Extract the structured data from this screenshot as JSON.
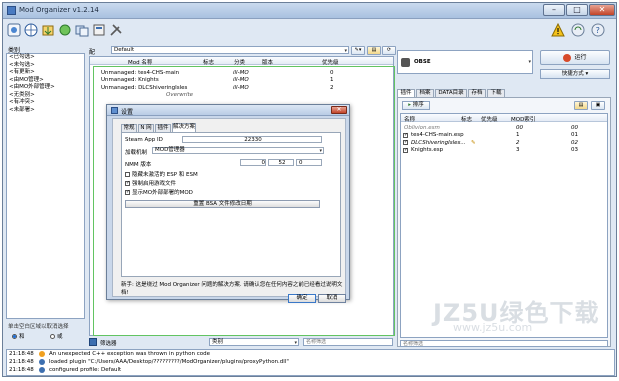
{
  "window": {
    "title": "Mod Organizer v1.2.14"
  },
  "left": {
    "title": "类别",
    "items": [
      "<已勾选>",
      "<未勾选>",
      "<有更新>",
      "<由MO管理>",
      "<由MO外部管理>",
      "<无类别>",
      "<有冲突>",
      "<未部署>"
    ],
    "footer": "单击空白区域以取消选择",
    "radio_and": "和",
    "radio_or": "或"
  },
  "profile": {
    "label": "配置文件",
    "value": "Default"
  },
  "modlist": {
    "headers": [
      "Mod 名称",
      "标志",
      "分类",
      "版本",
      "优先级"
    ],
    "overwrite": "Overwrite",
    "rows": [
      {
        "name": "Unmanaged: tes4-CHS-main",
        "cat": "ill-MO",
        "priority": "0"
      },
      {
        "name": "Unmanaged: Knights",
        "cat": "ill-MO",
        "priority": "1"
      },
      {
        "name": "Unmanaged: DLCShiveringIsles",
        "cat": "ill-MO",
        "priority": "2"
      }
    ]
  },
  "filter": {
    "label": "筛选器",
    "select": "类别",
    "placeholder": "名称筛选"
  },
  "dialog": {
    "title": "设置",
    "close": "✕",
    "tabs": [
      "常规",
      "N 网",
      "插件",
      "解决方案"
    ],
    "steam_label": "Steam App ID",
    "steam_value": "22330",
    "load_label": "加载机制",
    "load_value": "MOD管理器",
    "nmm_label": "NMM 版本",
    "nmm_values": [
      "0",
      "52",
      "0"
    ],
    "checks": [
      {
        "label": "隐藏未激活的 ESP 和 ESM",
        "on": false
      },
      {
        "label": "强制启用游戏文件",
        "on": true
      },
      {
        "label": "显示MO外部部署的MOD",
        "on": true
      }
    ],
    "reset": "重置 BSA 文件修改日期",
    "note": "新手: 这是绕过 Mod Organizer 问题的解决方案. 请确认您在任何内容之前已经看过说明文档!",
    "ok": "确定",
    "cancel": "取消"
  },
  "right": {
    "game_label": "OBSE",
    "run": "运行",
    "shortcut": "快捷方式",
    "tabs": [
      "插件",
      "档案",
      "DATA目录",
      "存档",
      "下载"
    ],
    "sort": "排序",
    "headers": [
      "名称",
      "标志",
      "优先级",
      "MOD索引"
    ],
    "rows": [
      {
        "name": "Oblivion.esm",
        "priority": "00",
        "index": "00",
        "italic": true,
        "checked": false
      },
      {
        "name": "tes4-CHS-main.esp",
        "priority": "1",
        "index": "01",
        "italic": false,
        "checked": true
      },
      {
        "name": "DLCShiveringIsles...",
        "priority": "2",
        "index": "02",
        "italic": true,
        "checked": true
      },
      {
        "name": "Knights.esp",
        "priority": "3",
        "index": "03",
        "italic": false,
        "checked": true
      }
    ],
    "filter_placeholder": "名称筛选"
  },
  "log": [
    {
      "time": "21:18:48",
      "msg": "An unexpected C++ exception was thrown in python code",
      "level": "warn"
    },
    {
      "time": "21:18:48",
      "msg": "loaded plugin \"C:/Users/AAA/Desktop/?????????/ModOrganizer/plugins/proxyPython.dll\"",
      "level": "info"
    },
    {
      "time": "21:18:48",
      "msg": "configured profile: Default",
      "level": "info"
    }
  ],
  "watermark": {
    "main": "JZ5U绿色下载",
    "sub": "www.jz5u.com"
  },
  "colors": {
    "accent": "#62c462",
    "window": "#dfe8f3",
    "title_gradient_top": "#c9daee"
  }
}
